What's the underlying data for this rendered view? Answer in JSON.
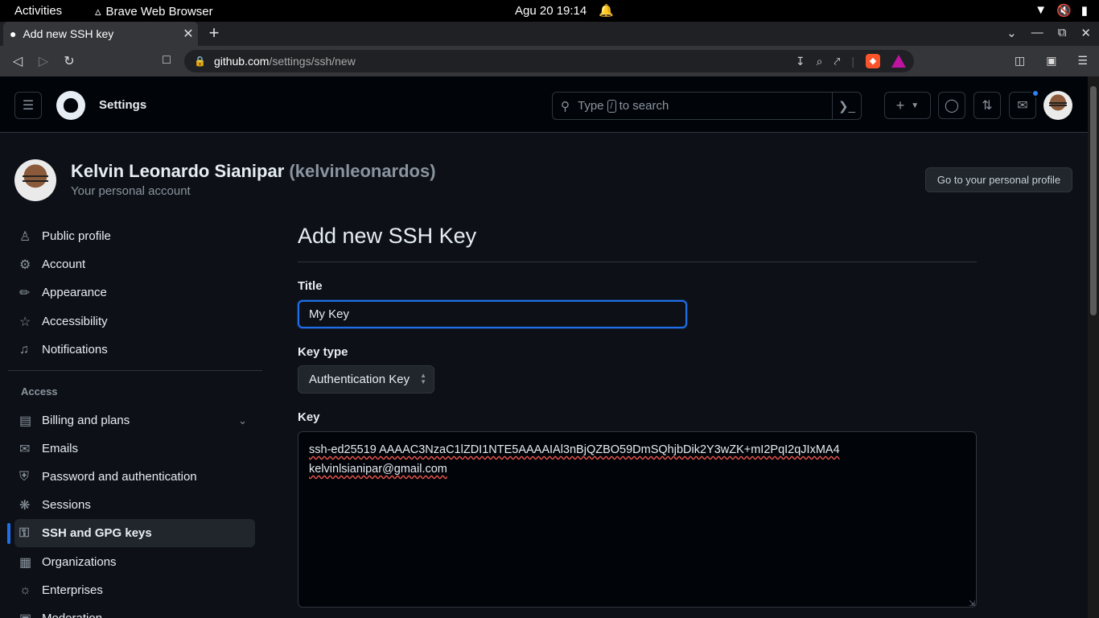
{
  "os": {
    "activities": "Activities",
    "app_name": "Brave Web Browser",
    "clock": "Agu 20  19:14"
  },
  "browser": {
    "tab_title": "Add new SSH key",
    "url_host": "github.com",
    "url_path": "/settings/ssh/new"
  },
  "header": {
    "section": "Settings",
    "search_prefix": "Type",
    "search_key": "/",
    "search_suffix": "to search"
  },
  "profile": {
    "name": "Kelvin Leonardo Sianipar",
    "login": "(kelvinleonardos)",
    "subtitle": "Your personal account",
    "profile_button": "Go to your personal profile"
  },
  "sidebar": {
    "items": [
      {
        "label": "Public profile",
        "icon": "person-icon"
      },
      {
        "label": "Account",
        "icon": "gear-icon"
      },
      {
        "label": "Appearance",
        "icon": "paintbrush-icon"
      },
      {
        "label": "Accessibility",
        "icon": "accessibility-icon"
      },
      {
        "label": "Notifications",
        "icon": "bell-icon"
      }
    ],
    "access_heading": "Access",
    "access_items": [
      {
        "label": "Billing and plans",
        "icon": "credit-card-icon"
      },
      {
        "label": "Emails",
        "icon": "mail-icon"
      },
      {
        "label": "Password and authentication",
        "icon": "shield-lock-icon"
      },
      {
        "label": "Sessions",
        "icon": "broadcast-icon"
      },
      {
        "label": "SSH and GPG keys",
        "icon": "key-icon"
      },
      {
        "label": "Organizations",
        "icon": "organization-icon"
      },
      {
        "label": "Enterprises",
        "icon": "globe-icon"
      },
      {
        "label": "Moderation",
        "icon": "report-icon"
      }
    ]
  },
  "form": {
    "page_title": "Add new SSH Key",
    "title_label": "Title",
    "title_value": "My Key",
    "key_type_label": "Key type",
    "key_type_value": "Authentication Key",
    "key_label": "Key",
    "key_line1": "ssh-ed25519 AAAAC3NzaC1lZDI1NTE5AAAAIAl3nBjQZBO59DmSQhjbDik2Y3wZK+mI2PqI2qJIxMA4",
    "key_line2": "kelvinlsianipar@gmail.com"
  },
  "colors": {
    "accent": "#1f6feb",
    "background": "#0d1117",
    "header_bg": "#010409",
    "notification_dot": "#2f81f7"
  }
}
